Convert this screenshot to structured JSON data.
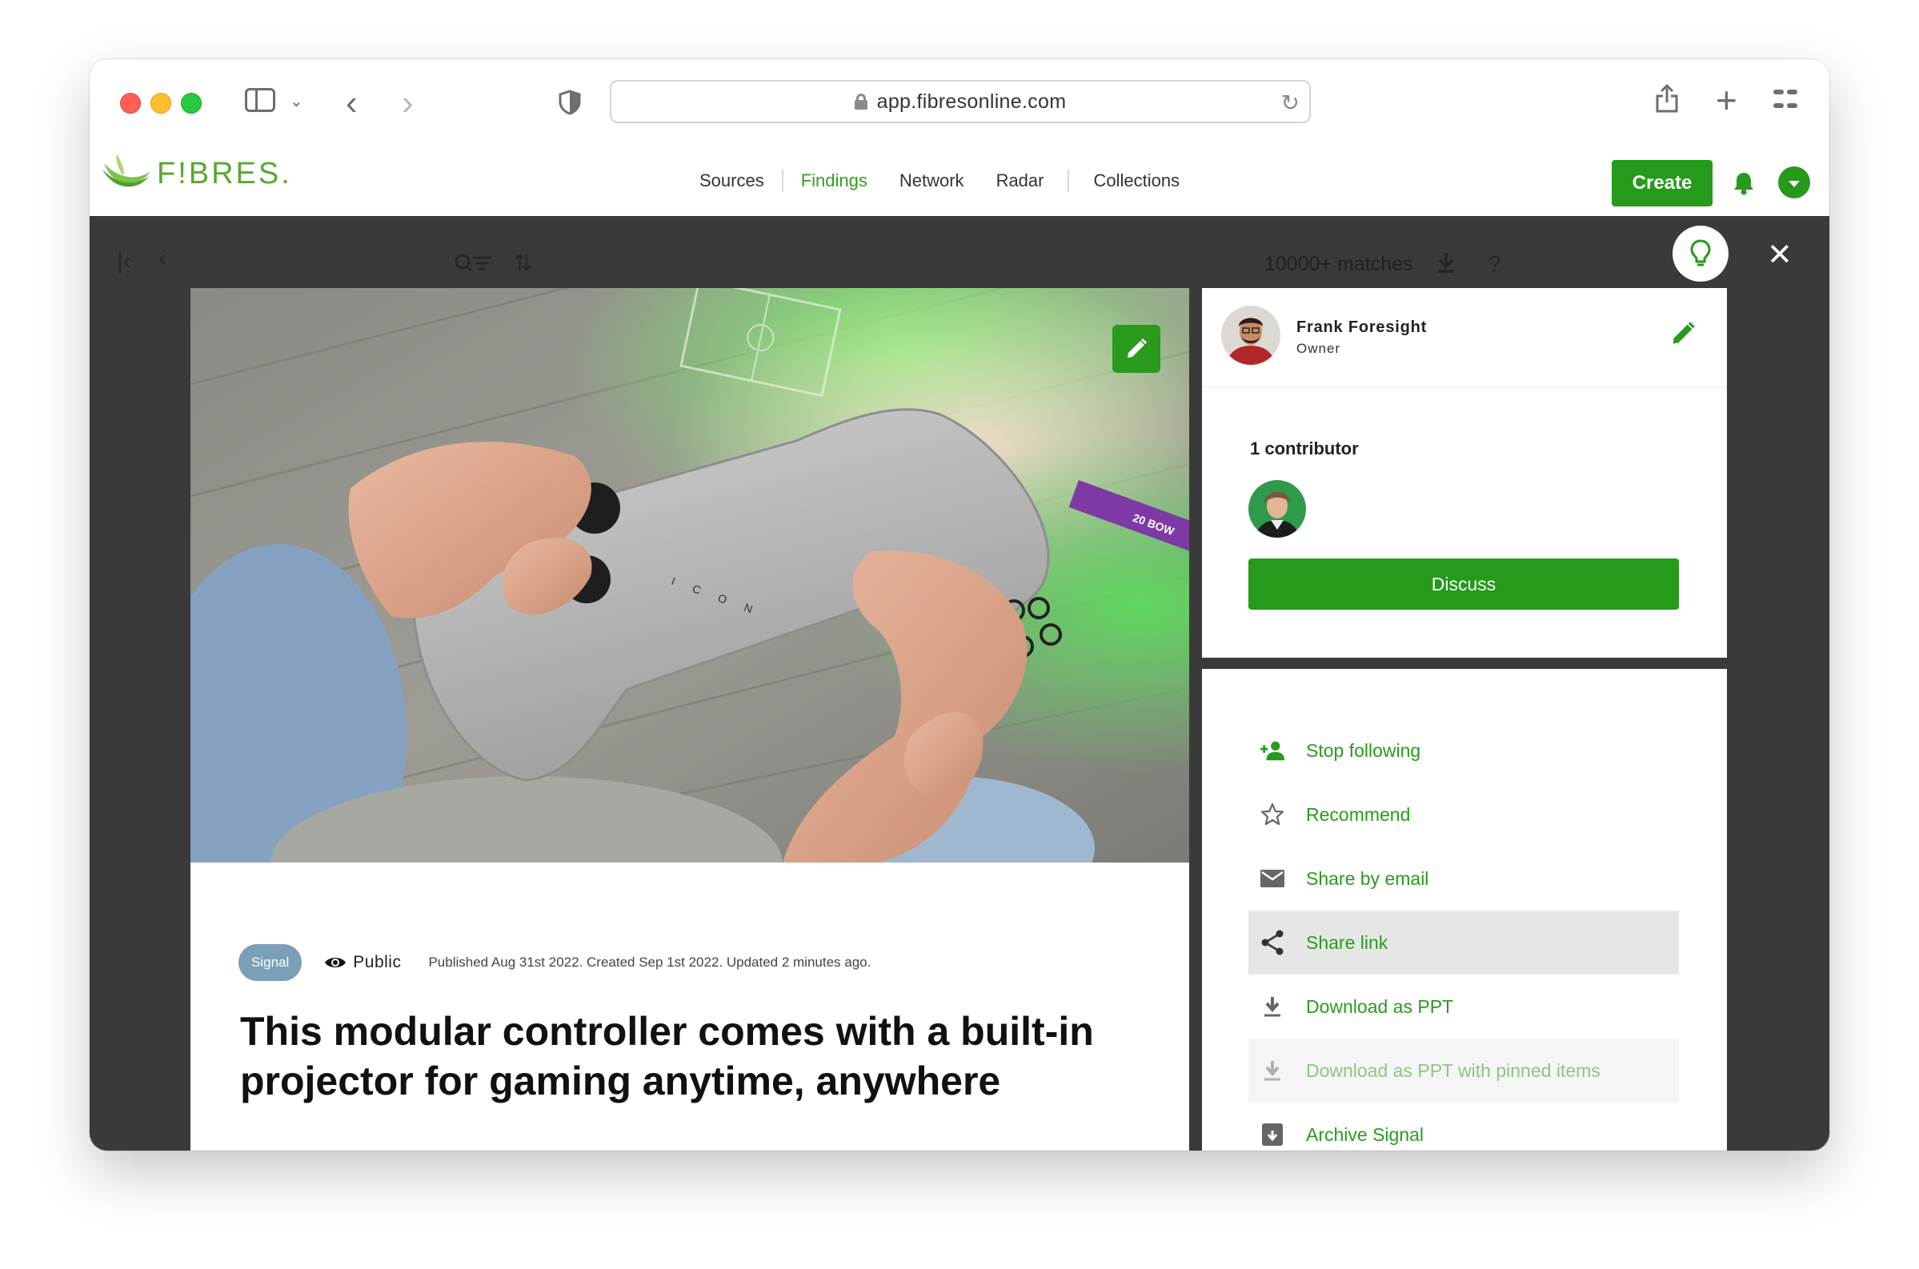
{
  "browser": {
    "url": "app.fibresonline.com"
  },
  "header": {
    "logo_text": "F!BRES.",
    "nav": [
      "Sources",
      "Findings",
      "Network",
      "Radar",
      "Collections"
    ],
    "active_nav": "Findings",
    "create_label": "Create",
    "colors": {
      "brand_green": "#259a1b",
      "accent_green": "#2ea01d"
    }
  },
  "toolbar": {
    "matches": "10000+ matches"
  },
  "article": {
    "badge": "Signal",
    "visibility": "Public",
    "dates": "Published Aug 31st 2022. Created Sep 1st 2022. Updated 2 minutes ago.",
    "title": "This modular controller comes with a built-in projector for gaming anytime, anywhere",
    "controller_brand": "I C O N",
    "banner_text": "20 BOW"
  },
  "owner": {
    "name": "Frank Foresight",
    "role": "Owner",
    "contributors_label": "1 contributor",
    "discuss_label": "Discuss"
  },
  "actions": [
    {
      "label": "Stop following",
      "icon": "person-add-icon",
      "state": "normal"
    },
    {
      "label": "Recommend",
      "icon": "star-outline-icon",
      "state": "normal"
    },
    {
      "label": "Share by email",
      "icon": "mail-icon",
      "state": "normal"
    },
    {
      "label": "Share link",
      "icon": "share-icon",
      "state": "hover"
    },
    {
      "label": "Download as PPT",
      "icon": "download-icon",
      "state": "normal"
    },
    {
      "label": "Download as PPT with pinned items",
      "icon": "download-icon",
      "state": "disabled"
    },
    {
      "label": "Archive Signal",
      "icon": "archive-icon",
      "state": "normal"
    }
  ]
}
